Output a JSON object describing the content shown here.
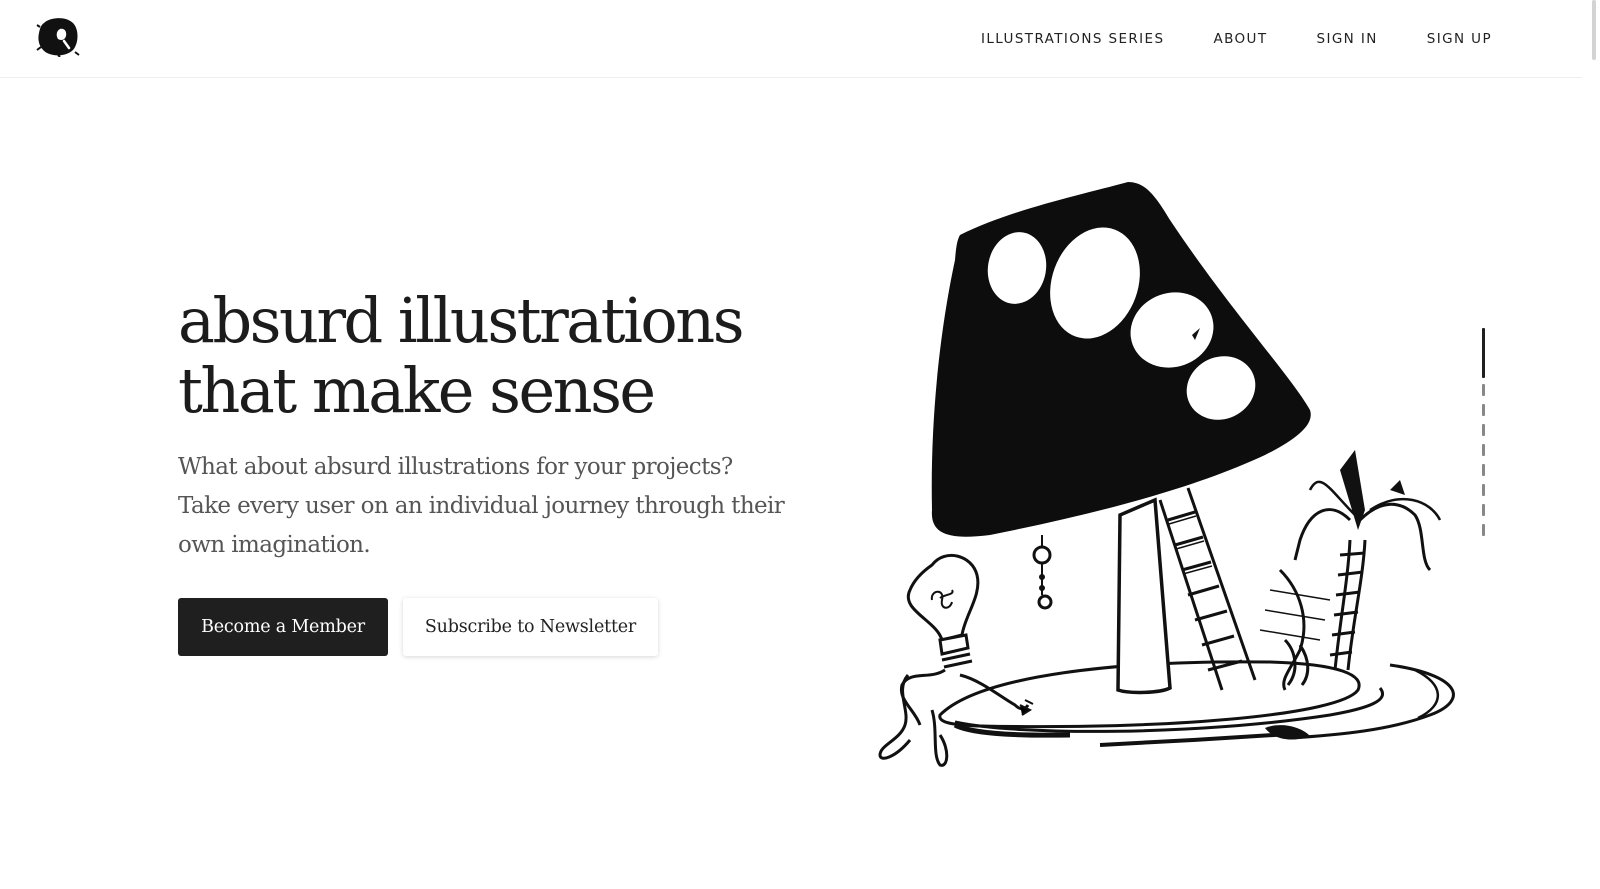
{
  "header": {
    "logo_icon": "blob-q-logo-icon",
    "nav": [
      {
        "label": "ILLUSTRATIONS SERIES"
      },
      {
        "label": "ABOUT"
      },
      {
        "label": "SIGN IN"
      },
      {
        "label": "SIGN UP"
      }
    ]
  },
  "hero": {
    "title_line1": "absurd illustrations",
    "title_line2": "that make sense",
    "subtitle": "What about absurd illustrations for your projects? Take every user on an individual journey through their own imagination.",
    "primary_button": "Become a Member",
    "secondary_button": "Subscribe to Newsletter",
    "illustration_icon": "mushroom-lamp-illustration"
  },
  "pager": {
    "slides": 9,
    "current": 1
  },
  "colors": {
    "text": "#1c1c1c",
    "subtitle": "#555555",
    "primary_bg": "#1f1f1f",
    "background": "#ffffff"
  }
}
